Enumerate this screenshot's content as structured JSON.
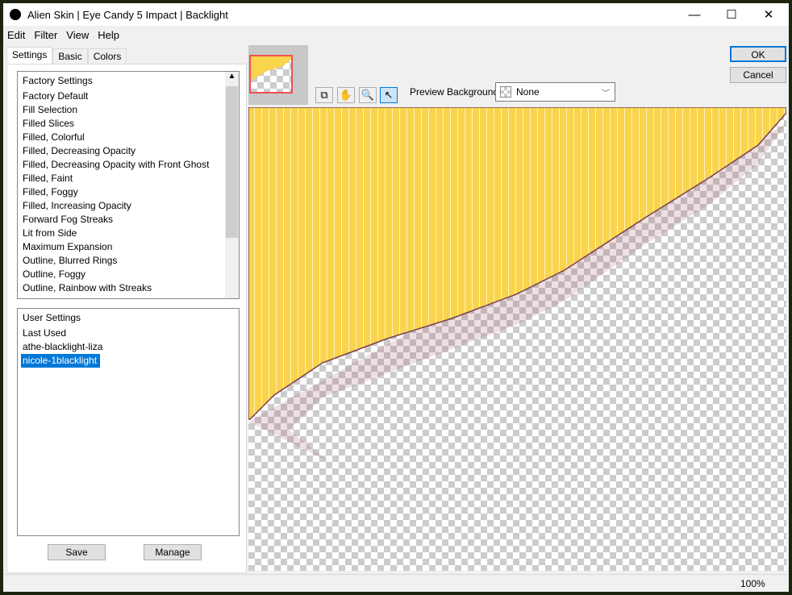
{
  "window": {
    "title": "Alien Skin | Eye Candy 5 Impact | Backlight",
    "minimize": "—",
    "maximize": "☐",
    "close": "✕"
  },
  "menu": [
    "Edit",
    "Filter",
    "View",
    "Help"
  ],
  "tabs": [
    "Settings",
    "Basic",
    "Colors"
  ],
  "factory": {
    "header": "Factory Settings",
    "items": [
      "Factory Default",
      "Fill Selection",
      "Filled Slices",
      "Filled, Colorful",
      "Filled, Decreasing Opacity",
      "Filled, Decreasing Opacity with Front Ghost",
      "Filled, Faint",
      "Filled, Foggy",
      "Filled, Increasing Opacity",
      "Forward Fog Streaks",
      "Lit from Side",
      "Maximum Expansion",
      "Outline, Blurred Rings",
      "Outline, Foggy",
      "Outline, Rainbow with Streaks"
    ]
  },
  "user": {
    "header": "User Settings",
    "items": [
      "Last Used",
      "athe-blacklight-liza"
    ],
    "selected": "nicole-1blacklight"
  },
  "buttons": {
    "save": "Save",
    "manage": "Manage",
    "ok": "OK",
    "cancel": "Cancel"
  },
  "preview": {
    "label": "Preview Background:",
    "value": "None",
    "fill_color": "#f9d44c",
    "zoom": "100%"
  },
  "tools": [
    "preview-toggle-icon",
    "hand-icon",
    "zoom-icon",
    "arrow-icon"
  ],
  "colors": {
    "accent": "#0078d7",
    "selection": "#0078d7",
    "thumbnail_border": "#f05050"
  }
}
